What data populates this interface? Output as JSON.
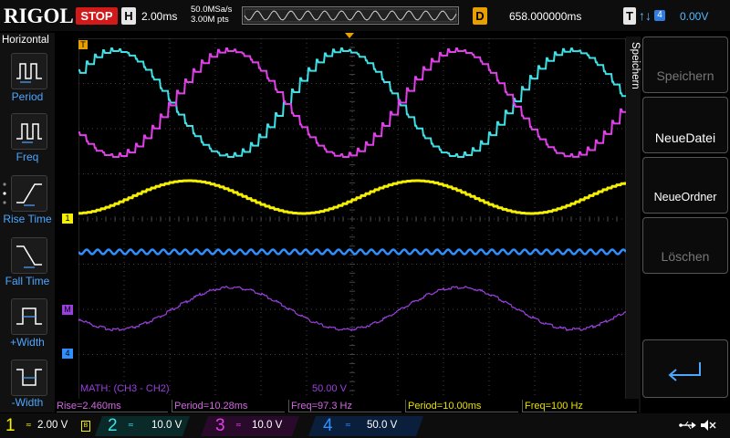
{
  "topbar": {
    "brand": "RIGOL",
    "run_status": "STOP",
    "h_label": "H",
    "timebase": "2.00ms",
    "sample_rate": "50.0MSa/s",
    "memory_depth": "3.00M pts",
    "d_label": "D",
    "delay": "658.000000ms",
    "t_label": "T",
    "trigger_source": "4",
    "trigger_level": "0.00V"
  },
  "left_panel": {
    "title": "Horizontal",
    "buttons": [
      {
        "label": "Period",
        "icon": "period-icon"
      },
      {
        "label": "Freq",
        "icon": "freq-icon"
      },
      {
        "label": "Rise Time",
        "icon": "rise-time-icon"
      },
      {
        "label": "Fall Time",
        "icon": "fall-time-icon"
      },
      {
        "label": "+Width",
        "icon": "plus-width-icon"
      },
      {
        "label": "-Width",
        "icon": "minus-width-icon"
      }
    ]
  },
  "right_panel": {
    "title": "Speichern",
    "buttons": [
      {
        "label": "Speichern",
        "enabled": false
      },
      {
        "label": "NeueDatei",
        "enabled": true
      },
      {
        "label": "NeueOrdner",
        "enabled": true
      },
      {
        "label": "Löschen",
        "enabled": false
      }
    ],
    "enter_icon": "enter-icon"
  },
  "waveform": {
    "markers": {
      "ch1": "1",
      "ch4": "4",
      "math": "M",
      "trigger_top": "T"
    },
    "math_label": "MATH: (CH3 - CH2)",
    "math_scale": "50.00 V",
    "colors": {
      "ch1": "#f5f000",
      "ch2": "#3fe0e6",
      "ch3": "#e040e8",
      "ch4": "#2f8fff",
      "math": "#9a40e0",
      "grid": "#444444",
      "accent": "#e8a000"
    }
  },
  "measurements": [
    {
      "text": "Rise=2.460ms",
      "channel": "ch3"
    },
    {
      "text": "Period=10.28ms",
      "channel": "ch3"
    },
    {
      "text": "Freq=97.3 Hz",
      "channel": "ch3"
    },
    {
      "text": "Period=10.00ms",
      "channel": "ch1"
    },
    {
      "text": "Freq=100 Hz",
      "channel": "ch1"
    }
  ],
  "channels": [
    {
      "num": "1",
      "scale": "2.00 V",
      "color": "#f5f000"
    },
    {
      "num": "2",
      "scale": "10.0 V",
      "color": "#3fe0e6"
    },
    {
      "num": "3",
      "scale": "10.0 V",
      "color": "#e040e8"
    },
    {
      "num": "4",
      "scale": "50.0 V",
      "color": "#2f8fff"
    }
  ],
  "status_icons": [
    "usb-icon",
    "mute-icon"
  ]
}
